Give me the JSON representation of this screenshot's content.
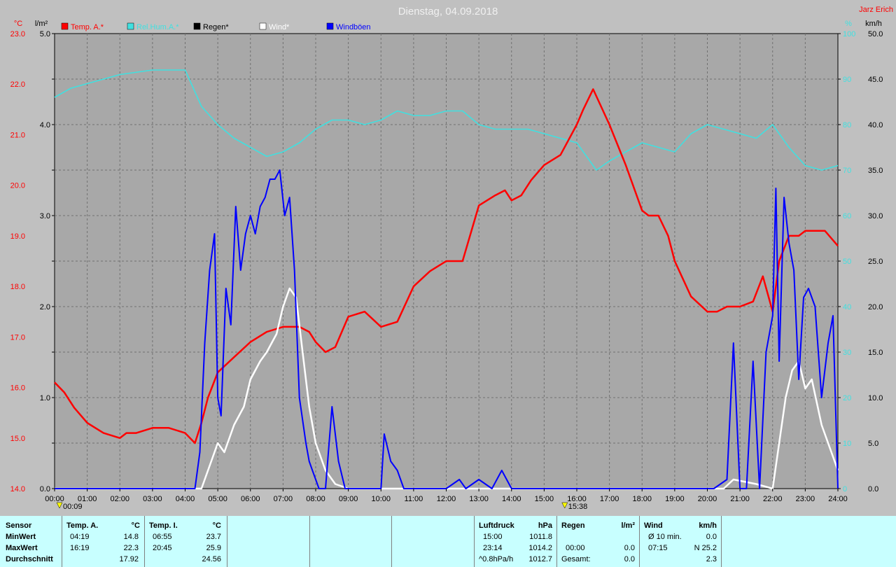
{
  "chart_data": {
    "type": "line",
    "title": "Dienstag, 04.09.2018",
    "author": "Jarz Erich",
    "x_unit": "time of day",
    "x_ticks": [
      "00:00",
      "01:00",
      "02:00",
      "03:00",
      "04:00",
      "05:00",
      "06:00",
      "07:00",
      "08:00",
      "09:00",
      "10:00",
      "11:00",
      "12:00",
      "13:00",
      "14:00",
      "15:00",
      "16:00",
      "17:00",
      "18:00",
      "19:00",
      "20:00",
      "21:00",
      "22:00",
      "23:00",
      "24:00"
    ],
    "x_range": [
      0,
      24
    ],
    "grid": true,
    "legend_position": "top",
    "axes": {
      "temp": {
        "unit": "°C",
        "range": [
          14.0,
          23.0
        ],
        "ticks": [
          "14.0",
          "15.0",
          "16.0",
          "17.0",
          "18.0",
          "19.0",
          "20.0",
          "21.0",
          "22.0",
          "23.0"
        ],
        "color": "#ff0000"
      },
      "rain": {
        "unit": "l/m²",
        "range": [
          0.0,
          5.0
        ],
        "ticks": [
          "0.0",
          "1.0",
          "2.0",
          "3.0",
          "4.0",
          "5.0"
        ],
        "color": "#000000"
      },
      "radiation": {
        "unit": "%",
        "range": [
          0,
          100
        ],
        "ticks": [
          "0",
          "10",
          "20",
          "30",
          "40",
          "50",
          "60",
          "70",
          "80",
          "90",
          "100"
        ],
        "color": "#40e0e0"
      },
      "wind": {
        "unit": "km/h",
        "range": [
          0.0,
          50.0
        ],
        "ticks": [
          "0.0",
          "5.0",
          "10.0",
          "15.0",
          "20.0",
          "25.0",
          "30.0",
          "35.0",
          "40.0",
          "45.0",
          "50.0"
        ],
        "color": "#000000"
      }
    },
    "markers": [
      {
        "label": "00:09",
        "x": 0.15
      },
      {
        "label": "15:38",
        "x": 15.63
      }
    ],
    "series": [
      {
        "name": "Temp. A.*",
        "axis": "temp",
        "color": "#ff0000",
        "x": [
          0,
          0.3,
          0.6,
          1,
          1.5,
          2,
          2.2,
          2.5,
          3,
          3.5,
          4,
          4.3,
          4.5,
          4.7,
          5,
          5.5,
          6,
          6.5,
          7,
          7.5,
          7.8,
          8,
          8.3,
          8.6,
          9,
          9.5,
          10,
          10.5,
          11,
          11.5,
          12,
          12.5,
          13,
          13.5,
          13.8,
          14,
          14.3,
          14.6,
          15,
          15.5,
          16,
          16.2,
          16.5,
          17,
          17.5,
          18,
          18.2,
          18.5,
          18.8,
          19,
          19.5,
          20,
          20.3,
          20.6,
          21,
          21.4,
          21.7,
          22,
          22.2,
          22.5,
          22.8,
          23,
          23.3,
          23.6,
          24
        ],
        "y": [
          16.1,
          15.9,
          15.6,
          15.3,
          15.1,
          15.0,
          15.1,
          15.1,
          15.2,
          15.2,
          15.1,
          14.9,
          15.3,
          15.8,
          16.3,
          16.6,
          16.9,
          17.1,
          17.2,
          17.2,
          17.1,
          16.9,
          16.7,
          16.8,
          17.4,
          17.5,
          17.2,
          17.3,
          18.0,
          18.3,
          18.5,
          18.5,
          19.6,
          19.8,
          19.9,
          19.7,
          19.8,
          20.1,
          20.4,
          20.6,
          21.2,
          21.5,
          21.9,
          21.2,
          20.4,
          19.5,
          19.4,
          19.4,
          19.0,
          18.5,
          17.8,
          17.5,
          17.5,
          17.6,
          17.6,
          17.7,
          18.2,
          17.5,
          18.5,
          19.0,
          19.0,
          19.1,
          19.1,
          19.1,
          18.8
        ]
      },
      {
        "name": "Regen*",
        "axis": "rain",
        "color": "#000000",
        "x": [
          0,
          24
        ],
        "y": [
          0.0,
          0.0
        ]
      },
      {
        "name": "Wind*",
        "axis": "wind",
        "color": "#ffffff",
        "x": [
          0,
          4.5,
          4.8,
          5,
          5.2,
          5.5,
          5.8,
          6,
          6.3,
          6.5,
          6.8,
          7,
          7.2,
          7.4,
          7.6,
          7.8,
          8,
          8.3,
          8.6,
          9,
          9.5,
          10,
          20.5,
          20.8,
          21.5,
          22,
          22.2,
          22.4,
          22.6,
          22.8,
          23,
          23.2,
          23.5,
          23.8,
          24
        ],
        "y": [
          0,
          0,
          3,
          5,
          4,
          7,
          9,
          12,
          14,
          15,
          17,
          20,
          22,
          21,
          15,
          9,
          5,
          2,
          0.5,
          0,
          0,
          0,
          0,
          1,
          0.5,
          0,
          5,
          10,
          13,
          14,
          11,
          12,
          7,
          4,
          2
        ]
      },
      {
        "name": "Windböen",
        "axis": "wind",
        "color": "#0000ff",
        "x": [
          0,
          4.3,
          4.45,
          4.6,
          4.75,
          4.9,
          5.0,
          5.1,
          5.25,
          5.4,
          5.55,
          5.7,
          5.85,
          6.0,
          6.15,
          6.3,
          6.45,
          6.6,
          6.75,
          6.9,
          7.05,
          7.2,
          7.35,
          7.5,
          7.7,
          7.8,
          7.9,
          8.0,
          8.1,
          8.3,
          8.5,
          8.7,
          8.9,
          9.0,
          10.0,
          10.1,
          10.3,
          10.5,
          10.7,
          12.0,
          12.4,
          12.6,
          13.0,
          13.4,
          13.7,
          14.0,
          19.5,
          20.2,
          20.6,
          20.8,
          21.0,
          21.2,
          21.4,
          21.6,
          21.8,
          22.0,
          22.1,
          22.2,
          22.35,
          22.5,
          22.65,
          22.8,
          22.95,
          23.1,
          23.3,
          23.5,
          23.7,
          23.85,
          24.0
        ],
        "y": [
          0,
          0,
          4,
          16,
          24,
          28,
          10,
          8,
          22,
          18,
          31,
          24,
          28,
          30,
          28,
          31,
          32,
          34,
          34,
          35,
          30,
          32,
          24,
          10,
          5,
          3,
          2,
          1,
          0,
          0,
          9,
          3,
          0,
          0,
          0,
          6,
          3,
          2,
          0,
          0,
          1,
          0,
          1,
          0,
          2,
          0,
          0,
          0,
          1,
          16,
          0,
          0,
          14,
          0,
          15,
          19,
          33,
          14,
          32,
          27,
          24,
          12,
          21,
          22,
          20,
          10,
          16,
          19,
          0
        ]
      }
    ],
    "legend_extra": [
      {
        "name": "Rel.Hum.A.*",
        "axis": "radiation",
        "color": "#40e0e0",
        "x": [
          0,
          0.5,
          1,
          2,
          3,
          4,
          4.5,
          5,
          5.5,
          6,
          6.5,
          7,
          7.5,
          8,
          8.5,
          9,
          9.5,
          10,
          10.5,
          11,
          11.5,
          12,
          12.5,
          13,
          13.5,
          14,
          14.5,
          15,
          15.5,
          16,
          16.3,
          16.6,
          17,
          17.5,
          18,
          18.5,
          19,
          19.5,
          20,
          20.5,
          21,
          21.5,
          22,
          22.5,
          23,
          23.5,
          24
        ],
        "y": [
          86,
          88,
          89,
          91,
          92,
          92,
          84,
          80,
          77,
          75,
          73,
          74,
          76,
          79,
          81,
          81,
          80,
          81,
          83,
          82,
          82,
          83,
          83,
          80,
          79,
          79,
          79,
          78,
          77,
          76,
          73,
          70,
          72,
          74,
          76,
          75,
          74,
          78,
          80,
          79,
          78,
          77,
          80,
          75,
          71,
          70,
          71
        ]
      }
    ]
  },
  "stats": {
    "sensor": {
      "header": "Sensor",
      "rows": [
        "MinWert",
        "MaxWert",
        "Durchschnitt"
      ]
    },
    "temp_a": {
      "header": "Temp. A.",
      "unit": "°C",
      "min_time": "04:19",
      "min_value": "14.8",
      "max_time": "16:19",
      "max_value": "22.3",
      "avg": "17.92"
    },
    "temp_i": {
      "header": "Temp. I.",
      "unit": "°C",
      "min_time": "06:55",
      "min_value": "23.7",
      "max_time": "20:45",
      "max_value": "25.9",
      "avg": "24.56"
    },
    "pressure": {
      "header": "Luftdruck",
      "unit": "hPa",
      "min_time": "15:00",
      "min_value": "1011.8",
      "max_time": "23:14",
      "max_value": "1014.2",
      "trend": "^0.8hPa/h",
      "avg": "1012.7"
    },
    "rain": {
      "header": "Regen",
      "unit": "l/m²",
      "max_time": "00:00",
      "max_value": "0.0",
      "total_label": "Gesamt:",
      "total_value": "0.0"
    },
    "wind": {
      "header": "Wind",
      "unit": "km/h",
      "avg_label": "Ø 10 min.",
      "avg_value": "0.0",
      "max_time": "07:15",
      "max_value": "N 25.2",
      "avg": "2.3"
    }
  }
}
